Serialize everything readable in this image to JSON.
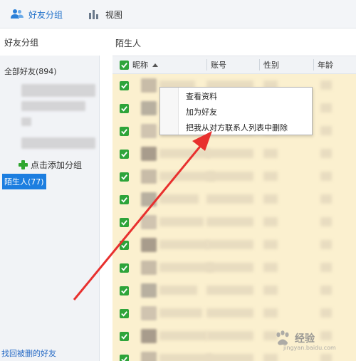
{
  "toolbar": {
    "friend_groups_label": "好友分组",
    "view_label": "视图"
  },
  "left_panel": {
    "header": "好友分组",
    "all_friends": "全部好友(894)",
    "add_group": "点击添加分组",
    "selected_group": "陌生人(77)",
    "find_deleted": "找回被删的好友"
  },
  "main": {
    "title": "陌生人",
    "columns": [
      "昵称",
      "账号",
      "性别",
      "年龄"
    ],
    "sorted_column": "昵称",
    "row_count": 13
  },
  "context_menu": {
    "items": [
      "查看资料",
      "加为好友",
      "把我从对方联系人列表中删除"
    ]
  },
  "watermark": {
    "text": "经验",
    "url": "jingyan.baidu.com"
  },
  "colors": {
    "accent": "#1c7ee0",
    "checkbox": "#2ea43a",
    "row_background": "#fbf0cf",
    "annotation_arrow": "#e8302e"
  }
}
